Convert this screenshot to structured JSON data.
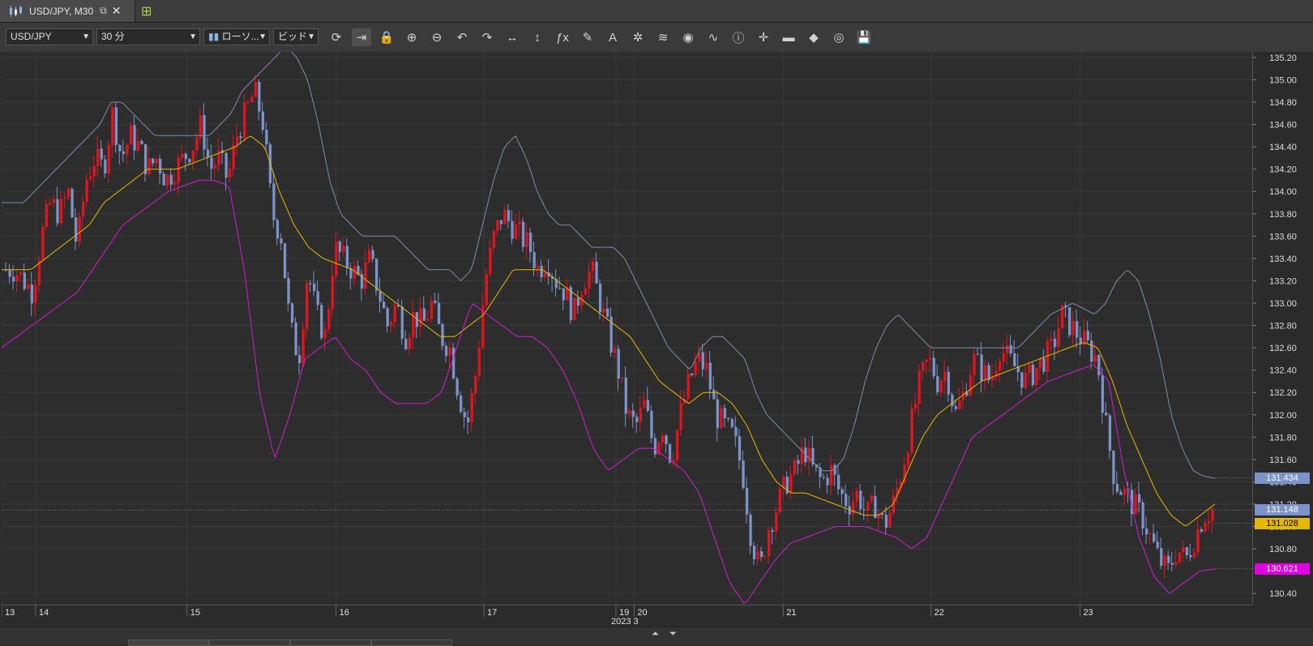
{
  "tab": {
    "title": "USD/JPY, M30",
    "popout_icon": "popout-icon",
    "close_icon": "close-icon",
    "add_icon": "add-chart-icon"
  },
  "toolbar": {
    "instrument": "USD/JPY",
    "period": "30 分",
    "chart_type": "ローソ...",
    "price_side": "ビッド",
    "buttons": [
      {
        "name": "refresh-icon",
        "glyph": "⟳"
      },
      {
        "name": "shift-chart-icon",
        "glyph": "⇥",
        "active": true
      },
      {
        "name": "lock-icon",
        "glyph": "🔒"
      },
      {
        "name": "zoom-in-icon",
        "glyph": "⊕"
      },
      {
        "name": "zoom-out-icon",
        "glyph": "⊖"
      },
      {
        "name": "undo-icon",
        "glyph": "↶"
      },
      {
        "name": "redo-icon",
        "glyph": "↷"
      },
      {
        "name": "horizontal-scale-icon",
        "glyph": "↔"
      },
      {
        "name": "vertical-scale-icon",
        "glyph": "↕"
      },
      {
        "name": "indicators-icon",
        "glyph": "ƒx"
      },
      {
        "name": "draw-icon",
        "glyph": "✎"
      },
      {
        "name": "text-icon",
        "glyph": "A"
      },
      {
        "name": "patterns-icon",
        "glyph": "✲"
      },
      {
        "name": "layers-icon",
        "glyph": "≋"
      },
      {
        "name": "visibility-icon",
        "glyph": "◉"
      },
      {
        "name": "alerts-icon",
        "glyph": "∿"
      },
      {
        "name": "info-icon",
        "glyph": "ⓘ"
      },
      {
        "name": "crosshair-icon",
        "glyph": "✛"
      },
      {
        "name": "color-theme-icon",
        "glyph": "▬"
      },
      {
        "name": "fill-icon",
        "glyph": "◆"
      },
      {
        "name": "template-icon",
        "glyph": "◎"
      },
      {
        "name": "save-icon",
        "glyph": "💾"
      }
    ]
  },
  "colors": {
    "bull": "#e0141e",
    "bear": "#7b93c8",
    "upper": "#7f8da8",
    "middle": "#e6b800",
    "lower": "#d21ed2"
  },
  "chart_data": {
    "type": "candlestick",
    "instrument": "USD/JPY",
    "timeframe": "M30",
    "month_label": "2023 3",
    "ylim": [
      130.3,
      135.25
    ],
    "y_ticks": [
      "130.40",
      "130.80",
      "131.00",
      "131.20",
      "131.40",
      "131.60",
      "131.80",
      "132.00",
      "132.20",
      "132.40",
      "132.60",
      "132.80",
      "133.00",
      "133.20",
      "133.40",
      "133.60",
      "133.80",
      "134.00",
      "134.20",
      "134.40",
      "134.60",
      "134.80",
      "135.00",
      "135.20"
    ],
    "x_labels": [
      {
        "label": "13",
        "pos": 0.0
      },
      {
        "label": "14",
        "pos": 0.028
      },
      {
        "label": "15",
        "pos": 0.153
      },
      {
        "label": "16",
        "pos": 0.276
      },
      {
        "label": "17",
        "pos": 0.398
      },
      {
        "label": "19",
        "pos": 0.507
      },
      {
        "label": "20",
        "pos": 0.522
      },
      {
        "label": "21",
        "pos": 0.645
      },
      {
        "label": "22",
        "pos": 0.767
      },
      {
        "label": "23",
        "pos": 0.89
      }
    ],
    "price_labels": [
      {
        "name": "upper-band-value",
        "value": "131.434",
        "bg": "#7b93c8",
        "fg": "#ffffff"
      },
      {
        "name": "current-price",
        "value": "131.148",
        "bg": "#7b93c8",
        "fg": "#ffffff"
      },
      {
        "name": "middle-band-value",
        "value": "131.028",
        "bg": "#e6b800",
        "fg": "#000000"
      },
      {
        "name": "lower-band-value",
        "value": "130.621",
        "bg": "#e000e0",
        "fg": "#ffffff"
      }
    ],
    "close_path": [
      133.3,
      133.3,
      133.2,
      133.1,
      133.6,
      133.9,
      133.8,
      134.0,
      133.5,
      134.1,
      134.3,
      134.2,
      134.7,
      134.3,
      134.5,
      134.4,
      134.2,
      134.3,
      134.1,
      134.2,
      134.3,
      134.4,
      134.6,
      134.2,
      134.3,
      134.1,
      134.5,
      134.7,
      134.9,
      134.6,
      133.8,
      133.6,
      132.8,
      132.5,
      133.3,
      132.9,
      132.7,
      133.5,
      133.4,
      133.3,
      133.2,
      133.4,
      133.1,
      132.8,
      133.0,
      132.7,
      132.9,
      132.8,
      133.0,
      132.7,
      132.6,
      132.2,
      131.9,
      132.4,
      133.2,
      133.6,
      133.8,
      133.7,
      133.6,
      133.5,
      133.3,
      133.4,
      133.2,
      133.1,
      132.9,
      133.2,
      133.3,
      133.0,
      132.7,
      132.4,
      132.0,
      131.9,
      132.1,
      131.7,
      131.9,
      131.6,
      132.0,
      132.3,
      132.5,
      132.4,
      132.0,
      131.9,
      131.8,
      131.5,
      130.9,
      130.6,
      131.0,
      131.2,
      131.4,
      131.5,
      131.7,
      131.5,
      131.4,
      131.5,
      131.3,
      131.2,
      131.3,
      131.1,
      131.2,
      131.0,
      131.2,
      131.5,
      131.9,
      132.3,
      132.5,
      132.3,
      132.4,
      132.0,
      132.2,
      132.5,
      132.4,
      132.3,
      132.6,
      132.5,
      132.4,
      132.3,
      132.4,
      132.5,
      132.6,
      132.9,
      132.8,
      132.7,
      132.6,
      132.5,
      131.9,
      131.4,
      131.3,
      131.2,
      131.1,
      130.9,
      130.7,
      130.6,
      130.8,
      130.7,
      130.9,
      131.1,
      131.15
    ],
    "upper_path": [
      133.9,
      133.9,
      133.9,
      134.0,
      134.1,
      134.2,
      134.3,
      134.4,
      134.5,
      134.6,
      134.8,
      134.8,
      134.7,
      134.6,
      134.5,
      134.5,
      134.5,
      134.5,
      134.5,
      134.5,
      134.6,
      134.7,
      134.9,
      135.0,
      135.1,
      135.2,
      135.3,
      135.2,
      135.0,
      134.6,
      134.1,
      133.8,
      133.7,
      133.6,
      133.6,
      133.6,
      133.6,
      133.5,
      133.4,
      133.3,
      133.3,
      133.3,
      133.2,
      133.3,
      133.7,
      134.1,
      134.4,
      134.5,
      134.3,
      134.0,
      133.8,
      133.7,
      133.7,
      133.6,
      133.5,
      133.5,
      133.5,
      133.4,
      133.2,
      133.0,
      132.8,
      132.6,
      132.5,
      132.4,
      132.6,
      132.7,
      132.7,
      132.6,
      132.5,
      132.2,
      132.0,
      131.9,
      131.8,
      131.7,
      131.6,
      131.5,
      131.5,
      131.6,
      131.9,
      132.3,
      132.6,
      132.8,
      132.9,
      132.8,
      132.7,
      132.6,
      132.6,
      132.6,
      132.6,
      132.6,
      132.6,
      132.6,
      132.6,
      132.6,
      132.7,
      132.8,
      132.9,
      132.95,
      133.0,
      132.95,
      132.9,
      133.0,
      133.2,
      133.3,
      133.2,
      132.9,
      132.5,
      132.0,
      131.7,
      131.5,
      131.45,
      131.43
    ],
    "middle_path": [
      133.3,
      133.3,
      133.3,
      133.4,
      133.5,
      133.6,
      133.7,
      133.9,
      134.0,
      134.1,
      134.2,
      134.2,
      134.2,
      134.25,
      134.3,
      134.35,
      134.4,
      134.5,
      134.4,
      134.0,
      133.7,
      133.5,
      133.4,
      133.35,
      133.3,
      133.2,
      133.1,
      133.0,
      132.9,
      132.8,
      132.7,
      132.7,
      132.8,
      132.9,
      133.1,
      133.3,
      133.3,
      133.3,
      133.2,
      133.1,
      133.0,
      132.9,
      132.8,
      132.7,
      132.5,
      132.3,
      132.2,
      132.1,
      132.2,
      132.2,
      132.1,
      131.9,
      131.6,
      131.4,
      131.3,
      131.3,
      131.25,
      131.2,
      131.15,
      131.1,
      131.1,
      131.2,
      131.5,
      131.8,
      132.0,
      132.1,
      132.2,
      132.3,
      132.35,
      132.4,
      132.45,
      132.5,
      132.55,
      132.6,
      132.65,
      132.6,
      132.3,
      131.9,
      131.6,
      131.3,
      131.1,
      131.0,
      131.1,
      131.2
    ],
    "lower_path": [
      132.6,
      132.7,
      132.8,
      132.9,
      133.0,
      133.1,
      133.3,
      133.5,
      133.7,
      133.8,
      133.9,
      134.0,
      134.05,
      134.1,
      134.1,
      134.05,
      133.3,
      132.2,
      131.6,
      132.0,
      132.5,
      132.6,
      132.7,
      132.5,
      132.4,
      132.2,
      132.1,
      132.1,
      132.1,
      132.2,
      132.6,
      133.0,
      132.9,
      132.8,
      132.7,
      132.7,
      132.6,
      132.4,
      132.1,
      131.7,
      131.5,
      131.6,
      131.7,
      131.7,
      131.6,
      131.5,
      131.3,
      130.9,
      130.5,
      130.3,
      130.5,
      130.7,
      130.85,
      130.9,
      130.95,
      131.0,
      131.0,
      131.0,
      130.95,
      130.9,
      130.8,
      130.9,
      131.2,
      131.5,
      131.8,
      131.9,
      132.0,
      132.1,
      132.2,
      132.3,
      132.35,
      132.4,
      132.45,
      132.3,
      131.5,
      130.9,
      130.55,
      130.4,
      130.5,
      130.6,
      130.62
    ]
  }
}
